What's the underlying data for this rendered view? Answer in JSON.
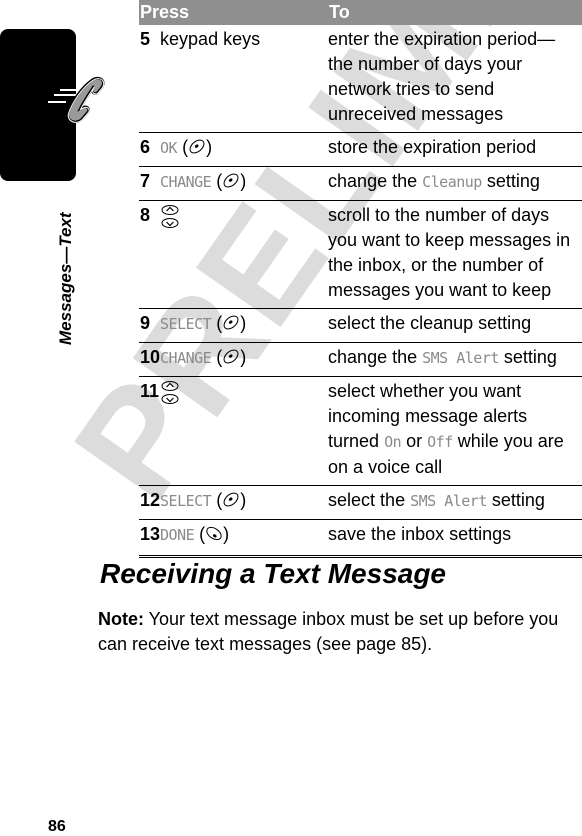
{
  "sidebar": {
    "section_label": "Messages—Text",
    "icon": "phone-handset-icon"
  },
  "page_number": "86",
  "watermark": "PRELIMINARY",
  "table": {
    "headers": {
      "press": "Press",
      "to": "To"
    },
    "rows": [
      {
        "step": "5",
        "press_text": "keypad keys",
        "to": "enter the expiration period—the number of days your network tries to send unreceived messages"
      },
      {
        "step": "6",
        "softkey": "OK",
        "key_icon": "right-softkey-icon",
        "to": "store the expiration period"
      },
      {
        "step": "7",
        "softkey": "CHANGE",
        "key_icon": "right-softkey-icon",
        "to_before": "change the ",
        "to_term": "Cleanup",
        "to_after": " setting"
      },
      {
        "step": "8",
        "key_icon": "scroll-up-down-icon",
        "to": "scroll to the number of days you want to keep messages in the inbox, or the number of messages you want to keep"
      },
      {
        "step": "9",
        "softkey": "SELECT",
        "key_icon": "right-softkey-icon",
        "to": "select the cleanup setting"
      },
      {
        "step": "10",
        "softkey": "CHANGE",
        "key_icon": "right-softkey-icon",
        "to_before": "change the ",
        "to_term": "SMS Alert",
        "to_after": " setting"
      },
      {
        "step": "11",
        "key_icon": "scroll-up-down-icon",
        "to_before": "select whether you want incoming message alerts turned ",
        "to_term": "On",
        "to_mid": " or ",
        "to_term2": "Off",
        "to_after": " while you are on a voice call"
      },
      {
        "step": "12",
        "softkey": "SELECT",
        "key_icon": "right-softkey-icon",
        "to_before": "select the ",
        "to_term": "SMS Alert",
        "to_after": " setting"
      },
      {
        "step": "13",
        "softkey": "DONE",
        "key_icon": "left-softkey-icon",
        "to": "save the inbox settings"
      }
    ]
  },
  "section": {
    "heading": "Receiving a Text Message",
    "note_label": "Note:",
    "note_text": " Your text message inbox must be set up before you can receive text messages (see page 85)."
  }
}
